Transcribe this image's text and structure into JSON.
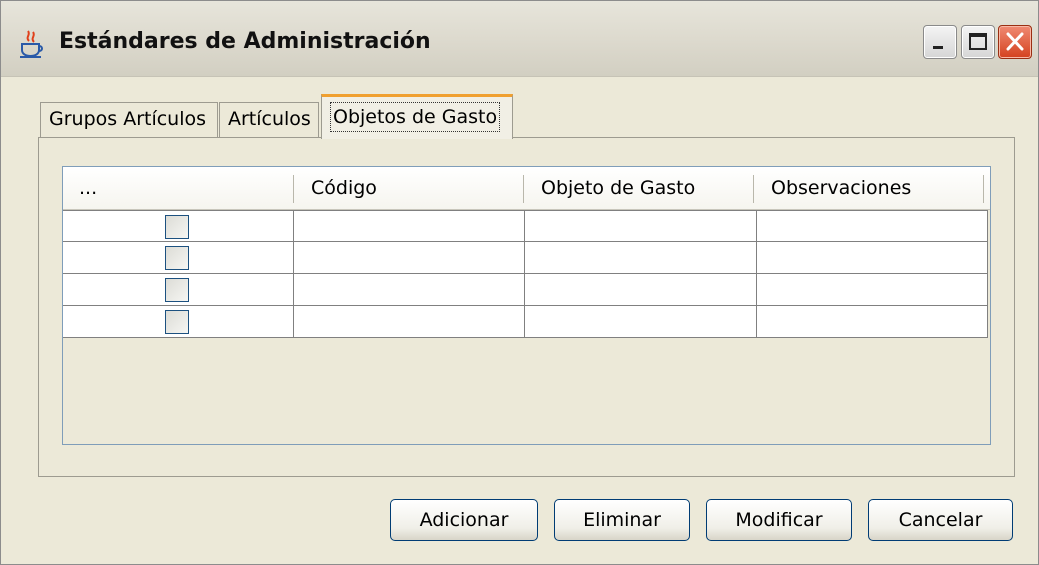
{
  "window": {
    "title": "Estándares de Administración",
    "icon": "java-coffee-icon"
  },
  "title_buttons": {
    "minimize_icon": "minimize-icon",
    "maximize_icon": "maximize-icon",
    "close_icon": "close-icon"
  },
  "tabs": [
    {
      "label": "Grupos Artículos",
      "selected": false
    },
    {
      "label": "Artículos",
      "selected": false
    },
    {
      "label": "Objetos de Gasto",
      "selected": true
    }
  ],
  "table": {
    "columns": [
      "...",
      "Código",
      "Objeto de Gasto",
      "Observaciones"
    ],
    "rows": [
      {
        "checked": false,
        "codigo": "",
        "objeto": "",
        "observaciones": ""
      },
      {
        "checked": false,
        "codigo": "",
        "objeto": "",
        "observaciones": ""
      },
      {
        "checked": false,
        "codigo": "",
        "objeto": "",
        "observaciones": ""
      },
      {
        "checked": false,
        "codigo": "",
        "objeto": "",
        "observaciones": ""
      }
    ]
  },
  "buttons": {
    "add": "Adicionar",
    "delete": "Eliminar",
    "modify": "Modificar",
    "cancel": "Cancelar"
  },
  "colors": {
    "window_bg": "#ece9d8",
    "close_button": "#d4411e",
    "active_tab_accent": "#f0a030",
    "table_border": "#7f9db9"
  }
}
